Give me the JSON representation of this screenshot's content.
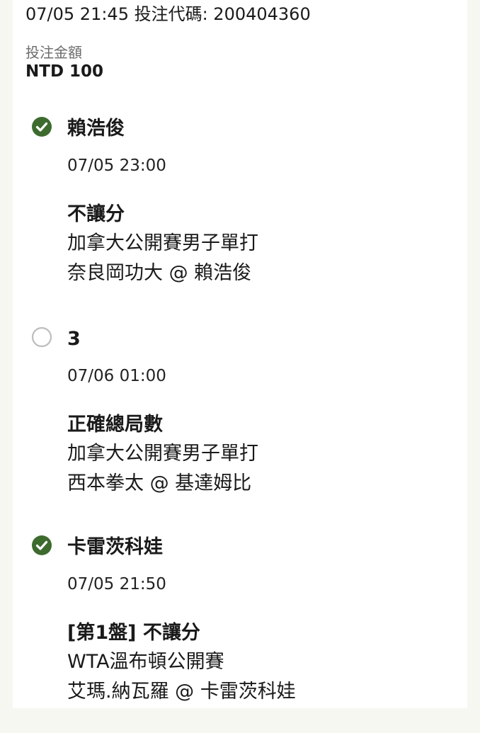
{
  "header": {
    "line": "07/05 21:45 投注代碼: 200404360",
    "amount_label": "投注金額",
    "amount_value": "NTD 100"
  },
  "colors": {
    "won": "#3d6b2e",
    "pending_ring": "#bdbdbd"
  },
  "bets": [
    {
      "status": "won",
      "status_icon": "check-circle-icon",
      "selection": "賴浩俊",
      "time": "07/05 23:00",
      "market": "不讓分",
      "event": "加拿大公開賽男子單打",
      "matchup": "奈良岡功大 @ 賴浩俊"
    },
    {
      "status": "pending",
      "status_icon": "empty-circle-icon",
      "selection": "3",
      "time": "07/06 01:00",
      "market": "正確總局數",
      "event": "加拿大公開賽男子單打",
      "matchup": "西本拳太 @ 基達姆比"
    },
    {
      "status": "won",
      "status_icon": "check-circle-icon",
      "selection": "卡雷茨科娃",
      "time": "07/05 21:50",
      "market": "[第1盤] 不讓分",
      "event": "WTA溫布頓公開賽",
      "matchup": "艾瑪.納瓦羅 @ 卡雷茨科娃"
    }
  ]
}
